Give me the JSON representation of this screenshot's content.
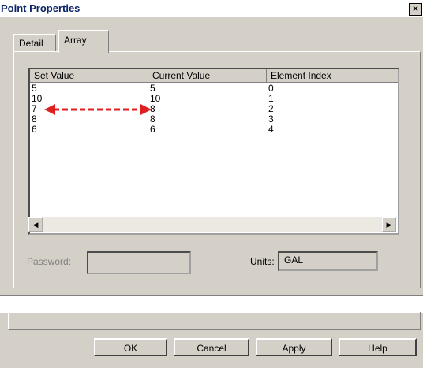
{
  "window": {
    "title": "Point Properties",
    "close_label": "×"
  },
  "tabs": [
    {
      "label": "Detail"
    },
    {
      "label": "Array"
    }
  ],
  "table": {
    "columns": [
      "Set Value",
      "Current Value",
      "Element Index"
    ],
    "rows": [
      {
        "set": "5",
        "current": "5",
        "index": "0"
      },
      {
        "set": "10",
        "current": "10",
        "index": "1"
      },
      {
        "set": "7",
        "current": "8",
        "index": "2"
      },
      {
        "set": "8",
        "current": "8",
        "index": "3"
      },
      {
        "set": "6",
        "current": "6",
        "index": "4"
      }
    ]
  },
  "annotation": {
    "arrow_color": "#e02020"
  },
  "form": {
    "password_label": "Password:",
    "password_value": "",
    "units_label": "Units:",
    "units_value": "GAL"
  },
  "buttons": {
    "ok": "OK",
    "cancel": "Cancel",
    "apply": "Apply",
    "help": "Help"
  },
  "scroll": {
    "left_icon": "◀",
    "right_icon": "▶"
  }
}
